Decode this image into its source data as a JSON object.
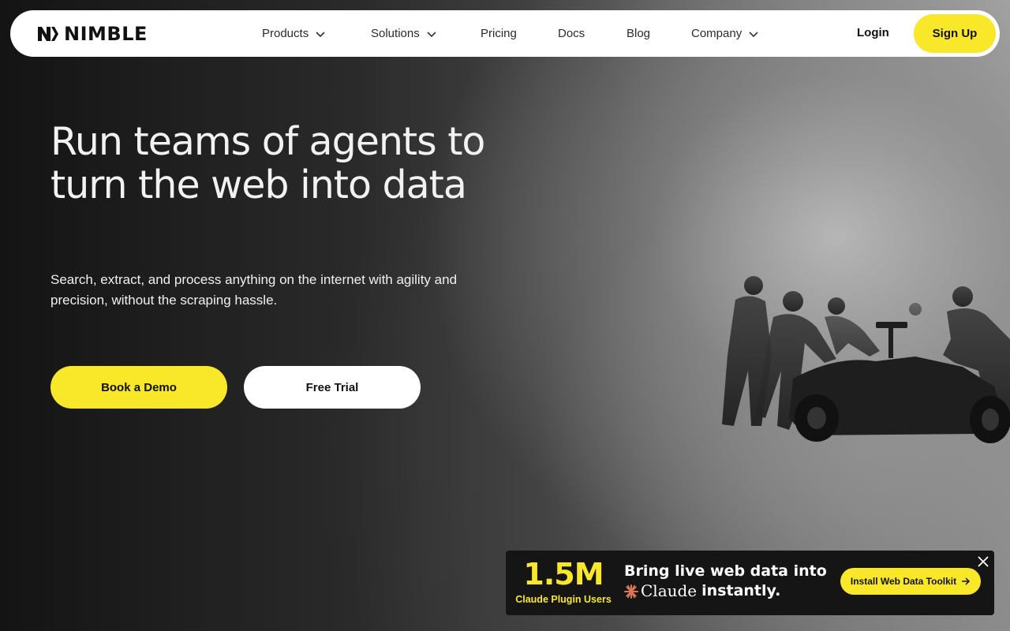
{
  "brand": {
    "name": "NIMBLE",
    "logo_icon": "nimble-logo-icon"
  },
  "nav": {
    "items": [
      {
        "label": "Products",
        "has_dropdown": true
      },
      {
        "label": "Solutions",
        "has_dropdown": true
      },
      {
        "label": "Pricing",
        "has_dropdown": false
      },
      {
        "label": "Docs",
        "has_dropdown": false
      },
      {
        "label": "Blog",
        "has_dropdown": false
      },
      {
        "label": "Company",
        "has_dropdown": true
      }
    ],
    "login_label": "Login",
    "signup_label": "Sign Up"
  },
  "hero": {
    "title": "Run teams of agents to turn the web into data",
    "subtitle": "Search, extract, and process anything on the internet with agility and precision, without the scraping hassle.",
    "primary_cta": "Book a Demo",
    "secondary_cta": "Free Trial"
  },
  "promo": {
    "stat_value": "1.5M",
    "stat_label": "Claude Plugin Users",
    "headline_line1": "Bring live web data into",
    "brand_word": "Claude",
    "headline_tail": "instantly.",
    "cta_label": "Install Web Data Toolkit",
    "close_icon": "close-icon"
  },
  "colors": {
    "accent_yellow": "#f9e82a",
    "nav_bg": "#ffffff",
    "promo_bg": "#151515",
    "claude_orange": "#d97757"
  }
}
